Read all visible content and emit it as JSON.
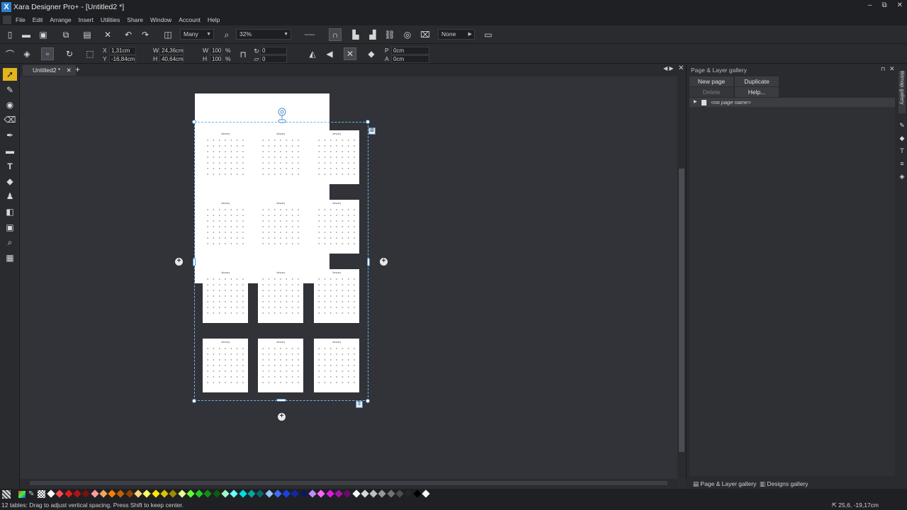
{
  "window": {
    "title": "Xara Designer Pro+ - [Untitled2 *]",
    "minimize": "–",
    "restore": "⧉",
    "close": "✕"
  },
  "menu": [
    "File",
    "Edit",
    "Arrange",
    "Insert",
    "Utilities",
    "Share",
    "Window",
    "Account",
    "Help"
  ],
  "toolbar1": {
    "selection_mode": "Many",
    "zoom": "32%",
    "blend": "None"
  },
  "toolbar2": {
    "x": "1,31cm",
    "y": "-16,84cm",
    "w": "24,36cm",
    "h": "40,64cm",
    "wp": "100",
    "hp": "100",
    "pct": "%",
    "rot": "0",
    "skew": "0",
    "p": "0cm",
    "a": "0cm",
    "labels": {
      "x": "X",
      "y": "Y",
      "w": "W",
      "h": "H",
      "p": "P",
      "a": "A"
    }
  },
  "doc_tab": {
    "label": "Untitled2 *",
    "close": "✕",
    "add": "+"
  },
  "calendar": {
    "month": "January",
    "weekdays": "M T W T F S S"
  },
  "gallery": {
    "title": "Page & Layer gallery",
    "new_page": "New page",
    "duplicate": "Duplicate",
    "delete": "Delete",
    "help": "Help...",
    "row": "<no page name>"
  },
  "side_tab": "Bitmap gallery",
  "gallery_tabs": {
    "page_layer": "Page & Layer gallery",
    "designs": "Designs gallery"
  },
  "status": {
    "message": "12 tables: Drag to adjust vertical spacing. Press Shift to keep center.",
    "coords": "25,6, -19,17cm"
  },
  "colors": [
    "#ffffff",
    "#ff4d4d",
    "#e01b1b",
    "#b31212",
    "#7a0f0f",
    "#ff9b9b",
    "#f2a65a",
    "#ff7f00",
    "#c95f00",
    "#8f4300",
    "#ffd27f",
    "#ffff66",
    "#ffe600",
    "#d9c400",
    "#9c8f00",
    "#e6ff8a",
    "#66ff33",
    "#22cc22",
    "#128f12",
    "#0c5c0c",
    "#9cffc9",
    "#66ffff",
    "#00e0e0",
    "#00a8a8",
    "#006b6b",
    "#9cc4ff",
    "#3d6dff",
    "#1f3fe6",
    "#1426a8",
    "#0a1566",
    "#c28cff",
    "#ff66ff",
    "#e01be0",
    "#a812a8",
    "#6b0c6b",
    "#f5f5f5",
    "#d9d9d9",
    "#bfbfbf",
    "#999999",
    "#737373",
    "#4d4d4d",
    "#262626",
    "#000000",
    "#ffffff"
  ]
}
